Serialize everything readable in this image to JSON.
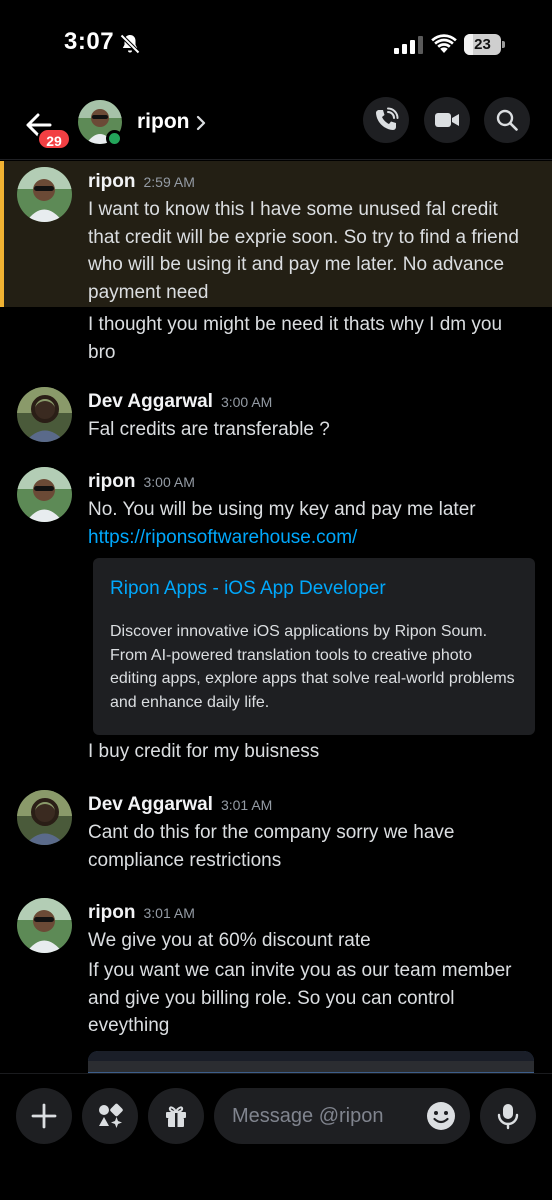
{
  "status_bar": {
    "time": "3:07",
    "battery": "23"
  },
  "header": {
    "back_badge": "29",
    "name": "ripon"
  },
  "messages": [
    {
      "author": "ripon",
      "time": "2:59 AM",
      "lines": [
        "I want to know this I have some unused fal credit that credit will be exprie soon. So try to find a friend who will be using it and pay me later. No advance payment need",
        "I thought you might be need it thats why I dm you bro"
      ]
    },
    {
      "author": "Dev Aggarwal",
      "time": "3:00 AM",
      "lines": [
        "Fal credits are transferable ?"
      ]
    },
    {
      "author": "ripon",
      "time": "3:00 AM",
      "lines": [
        "No. You will be using my key and pay me later"
      ],
      "link": "https://riponsoftwarehouse.com/",
      "embed": {
        "title": "Ripon Apps - iOS App Developer",
        "description": "Discover innovative iOS applications by Ripon Soum. From AI-powered translation tools to creative photo editing apps, explore apps that solve real-world problems and enhance daily life."
      },
      "after": "I buy credit for my buisness"
    },
    {
      "author": "Dev Aggarwal",
      "time": "3:01 AM",
      "lines": [
        "Cant do this for the company sorry we have compliance restrictions"
      ]
    },
    {
      "author": "ripon",
      "time": "3:01 AM",
      "lines": [
        "We give you at 60% discount rate",
        "If you want we can invite you as our team member and give you billing role. So you can control eveything"
      ]
    }
  ],
  "composer": {
    "placeholder": "Message @ripon"
  },
  "colors": {
    "accent_link": "#00a8fc",
    "mention_highlight": "#f0b232",
    "online": "#23a55a",
    "badge": "#f23f43"
  },
  "icons": [
    "back-arrow-icon",
    "phone-icon",
    "video-icon",
    "search-icon",
    "plus-icon",
    "apps-icon",
    "gift-icon",
    "emoji-icon",
    "microphone-icon",
    "mute-bell-icon",
    "signal-icon",
    "wifi-icon"
  ]
}
